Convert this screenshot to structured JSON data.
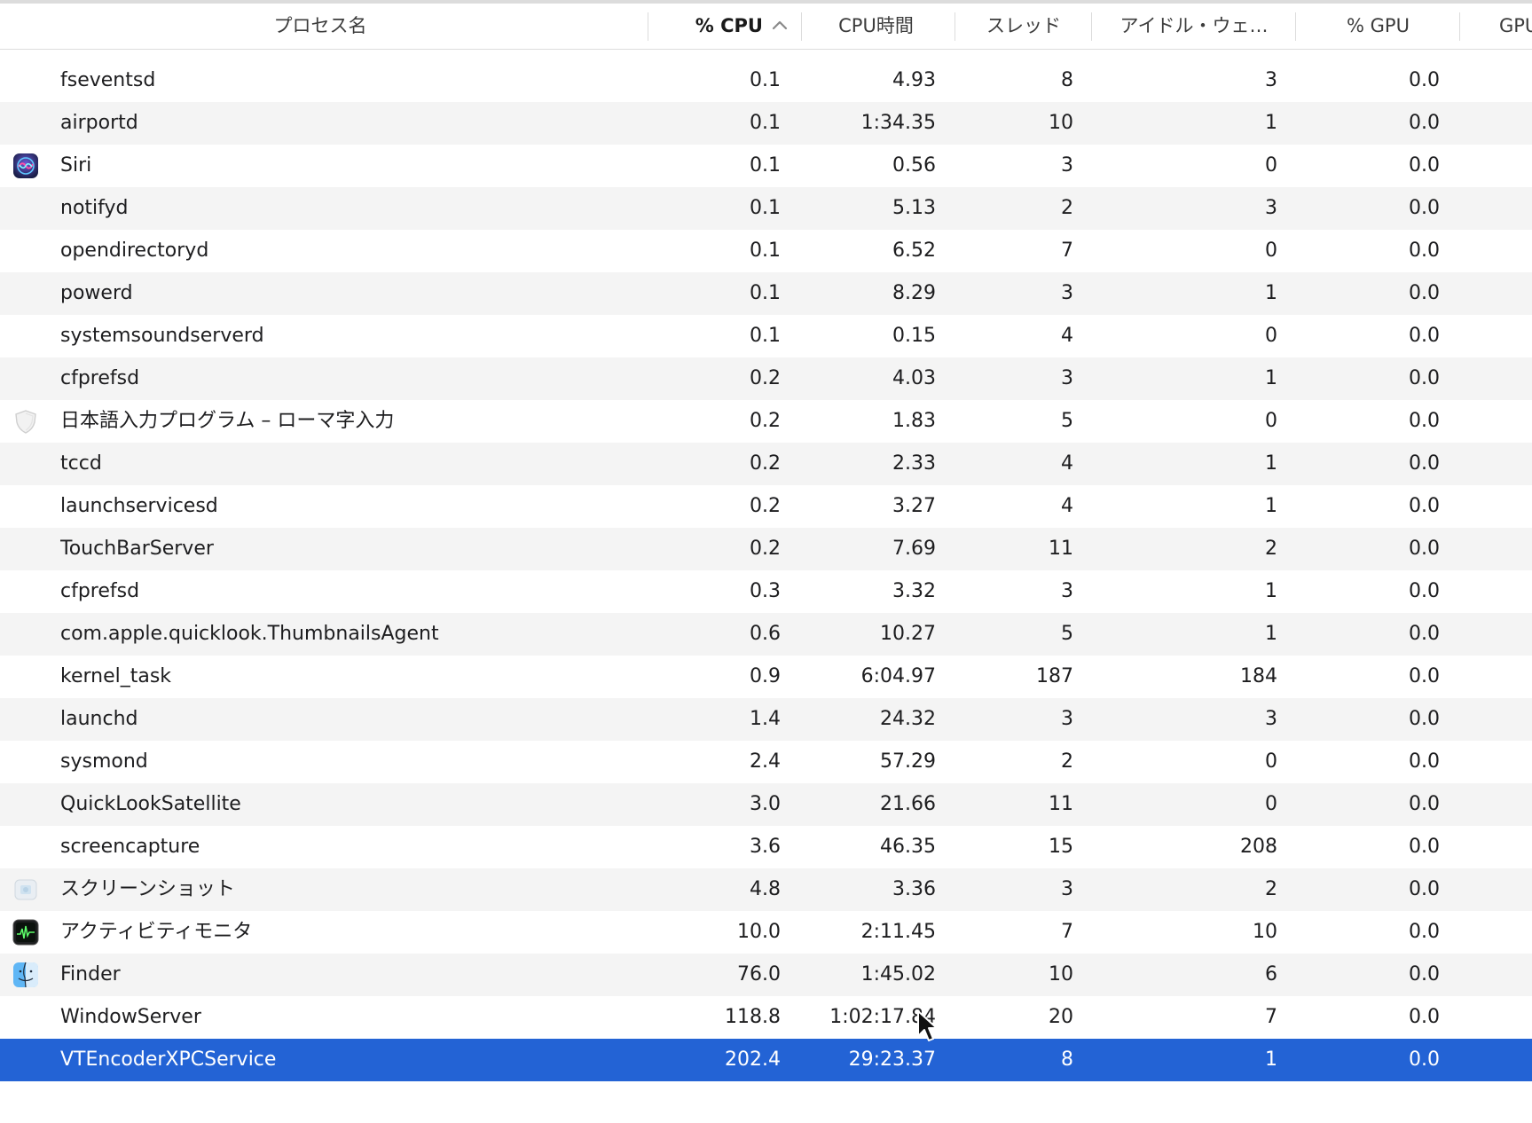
{
  "header": {
    "col_name": "プロセス名",
    "col_cpu": "% CPU",
    "col_time": "CPU時間",
    "col_threads": "スレッド",
    "col_idle": "アイドル・ウェ…",
    "col_gpu": "% GPU",
    "col_gpu_time": "GPU"
  },
  "rows": [
    {
      "name": "fseventsd",
      "cpu": "0.1",
      "time": "4.93",
      "threads": "8",
      "idle": "3",
      "gpu": "0.0",
      "icon": ""
    },
    {
      "name": "airportd",
      "cpu": "0.1",
      "time": "1:34.35",
      "threads": "10",
      "idle": "1",
      "gpu": "0.0",
      "icon": ""
    },
    {
      "name": "Siri",
      "cpu": "0.1",
      "time": "0.56",
      "threads": "3",
      "idle": "0",
      "gpu": "0.0",
      "icon": "siri-icon"
    },
    {
      "name": "notifyd",
      "cpu": "0.1",
      "time": "5.13",
      "threads": "2",
      "idle": "3",
      "gpu": "0.0",
      "icon": ""
    },
    {
      "name": "opendirectoryd",
      "cpu": "0.1",
      "time": "6.52",
      "threads": "7",
      "idle": "0",
      "gpu": "0.0",
      "icon": ""
    },
    {
      "name": "powerd",
      "cpu": "0.1",
      "time": "8.29",
      "threads": "3",
      "idle": "1",
      "gpu": "0.0",
      "icon": ""
    },
    {
      "name": "systemsoundserverd",
      "cpu": "0.1",
      "time": "0.15",
      "threads": "4",
      "idle": "0",
      "gpu": "0.0",
      "icon": ""
    },
    {
      "name": "cfprefsd",
      "cpu": "0.2",
      "time": "4.03",
      "threads": "3",
      "idle": "1",
      "gpu": "0.0",
      "icon": ""
    },
    {
      "name": "日本語入力プログラム – ローマ字入力",
      "cpu": "0.2",
      "time": "1.83",
      "threads": "5",
      "idle": "0",
      "gpu": "0.0",
      "icon": "shield-icon"
    },
    {
      "name": "tccd",
      "cpu": "0.2",
      "time": "2.33",
      "threads": "4",
      "idle": "1",
      "gpu": "0.0",
      "icon": ""
    },
    {
      "name": "launchservicesd",
      "cpu": "0.2",
      "time": "3.27",
      "threads": "4",
      "idle": "1",
      "gpu": "0.0",
      "icon": ""
    },
    {
      "name": "TouchBarServer",
      "cpu": "0.2",
      "time": "7.69",
      "threads": "11",
      "idle": "2",
      "gpu": "0.0",
      "icon": ""
    },
    {
      "name": "cfprefsd",
      "cpu": "0.3",
      "time": "3.32",
      "threads": "3",
      "idle": "1",
      "gpu": "0.0",
      "icon": ""
    },
    {
      "name": "com.apple.quicklook.ThumbnailsAgent",
      "cpu": "0.6",
      "time": "10.27",
      "threads": "5",
      "idle": "1",
      "gpu": "0.0",
      "icon": ""
    },
    {
      "name": "kernel_task",
      "cpu": "0.9",
      "time": "6:04.97",
      "threads": "187",
      "idle": "184",
      "gpu": "0.0",
      "icon": ""
    },
    {
      "name": "launchd",
      "cpu": "1.4",
      "time": "24.32",
      "threads": "3",
      "idle": "3",
      "gpu": "0.0",
      "icon": ""
    },
    {
      "name": "sysmond",
      "cpu": "2.4",
      "time": "57.29",
      "threads": "2",
      "idle": "0",
      "gpu": "0.0",
      "icon": ""
    },
    {
      "name": "QuickLookSatellite",
      "cpu": "3.0",
      "time": "21.66",
      "threads": "11",
      "idle": "0",
      "gpu": "0.0",
      "icon": ""
    },
    {
      "name": "screencapture",
      "cpu": "3.6",
      "time": "46.35",
      "threads": "15",
      "idle": "208",
      "gpu": "0.0",
      "icon": ""
    },
    {
      "name": "スクリーンショット",
      "cpu": "4.8",
      "time": "3.36",
      "threads": "3",
      "idle": "2",
      "gpu": "0.0",
      "icon": "screenshot-icon"
    },
    {
      "name": "アクティビティモニタ",
      "cpu": "10.0",
      "time": "2:11.45",
      "threads": "7",
      "idle": "10",
      "gpu": "0.0",
      "icon": "activity-monitor-icon"
    },
    {
      "name": "Finder",
      "cpu": "76.0",
      "time": "1:45.02",
      "threads": "10",
      "idle": "6",
      "gpu": "0.0",
      "icon": "finder-icon"
    },
    {
      "name": "WindowServer",
      "cpu": "118.8",
      "time": "1:02:17.84",
      "threads": "20",
      "idle": "7",
      "gpu": "0.0",
      "icon": ""
    },
    {
      "name": "VTEncoderXPCService",
      "cpu": "202.4",
      "time": "29:23.37",
      "threads": "8",
      "idle": "1",
      "gpu": "0.0",
      "icon": "",
      "selected": true
    }
  ],
  "colors": {
    "selection": "#2363d5",
    "alt_row": "#f4f4f4",
    "separator": "#dcdcdc"
  }
}
